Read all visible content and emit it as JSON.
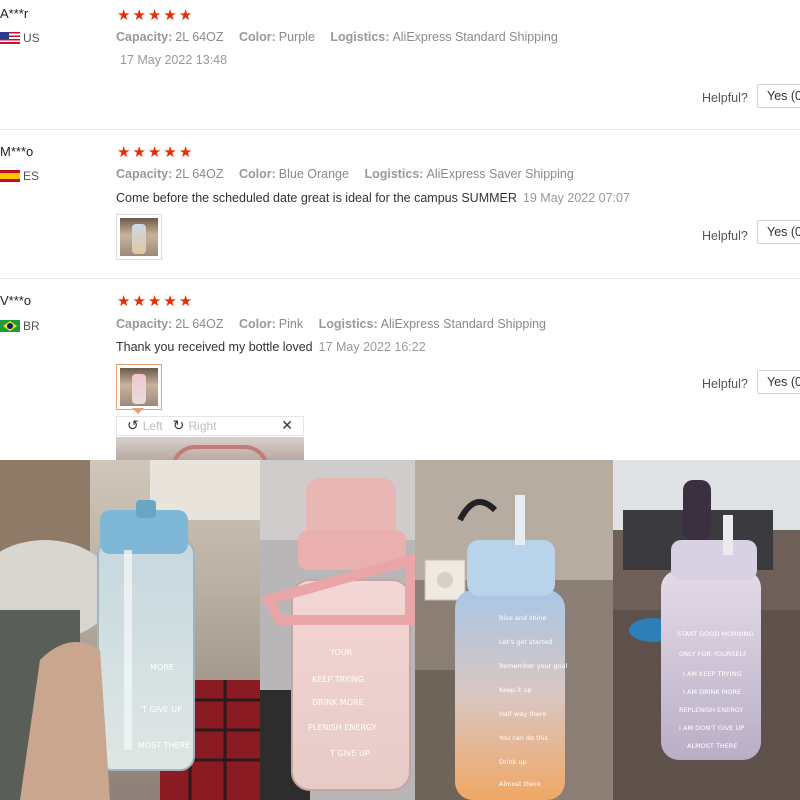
{
  "reviews": [
    {
      "user": "A***r",
      "country": "US",
      "flag": "us-flag-icon",
      "rating": 5,
      "capacity_label": "Capacity:",
      "capacity": "2L 64OZ",
      "color_label": "Color:",
      "color": "Purple",
      "logistics_label": "Logistics:",
      "logistics": "AliExpress Standard Shipping",
      "comment": "",
      "date": "17 May 2022 13:48",
      "helpful_label": "Helpful?",
      "yes_label": "Yes (0"
    },
    {
      "user": "M***o",
      "country": "ES",
      "flag": "es-flag-icon",
      "rating": 5,
      "capacity_label": "Capacity:",
      "capacity": "2L 64OZ",
      "color_label": "Color:",
      "color": "Blue Orange",
      "logistics_label": "Logistics:",
      "logistics": "AliExpress Saver Shipping",
      "comment": "Come before the scheduled date great is ideal for the campus SUMMER",
      "date": "19 May 2022 07:07",
      "helpful_label": "Helpful?",
      "yes_label": "Yes (0"
    },
    {
      "user": "V***o",
      "country": "BR",
      "flag": "br-flag-icon",
      "rating": 5,
      "capacity_label": "Capacity:",
      "capacity": "2L 64OZ",
      "color_label": "Color:",
      "color": "Pink",
      "logistics_label": "Logistics:",
      "logistics": "AliExpress Standard Shipping",
      "comment": "Thank you received my bottle loved",
      "date": "17 May 2022 16:22",
      "helpful_label": "Helpful?",
      "yes_label": "Yes (0"
    }
  ],
  "star_glyph": "★",
  "image_viewer": {
    "rotate_left_icon": "rotate-left-icon",
    "rotate_left_label": "Left",
    "rotate_right_icon": "rotate-right-icon",
    "rotate_right_label": "Right",
    "close_icon": "close-icon",
    "close_glyph": "✕"
  },
  "bottle_text": {
    "blue": [
      "MORE",
      "'T GIVE UP",
      "MOST THERE"
    ],
    "pink": [
      "YOUR",
      "KEEP TRYING",
      "DRINK MORE",
      "PLENISH ENERGY",
      "T GIVE UP"
    ],
    "gradient": [
      "Rise and shine",
      "Let's get started",
      "Remember your goal",
      "Keep it up",
      "Half way there",
      "You can do this",
      "Drink up",
      "Almost there"
    ],
    "purple": [
      "START GOOD MORNING",
      "ONLY FOR YOURSELF",
      "I AM KEEP TRYING",
      "I AM DRINK MORE",
      "REPLENISH ENERGY",
      "I AM DON'T GIVE UP",
      "ALMOST THERE"
    ]
  },
  "colors": {
    "star": "#e62e04",
    "accent_border": "#e8a070",
    "meta_gray": "#8a8a8a"
  }
}
